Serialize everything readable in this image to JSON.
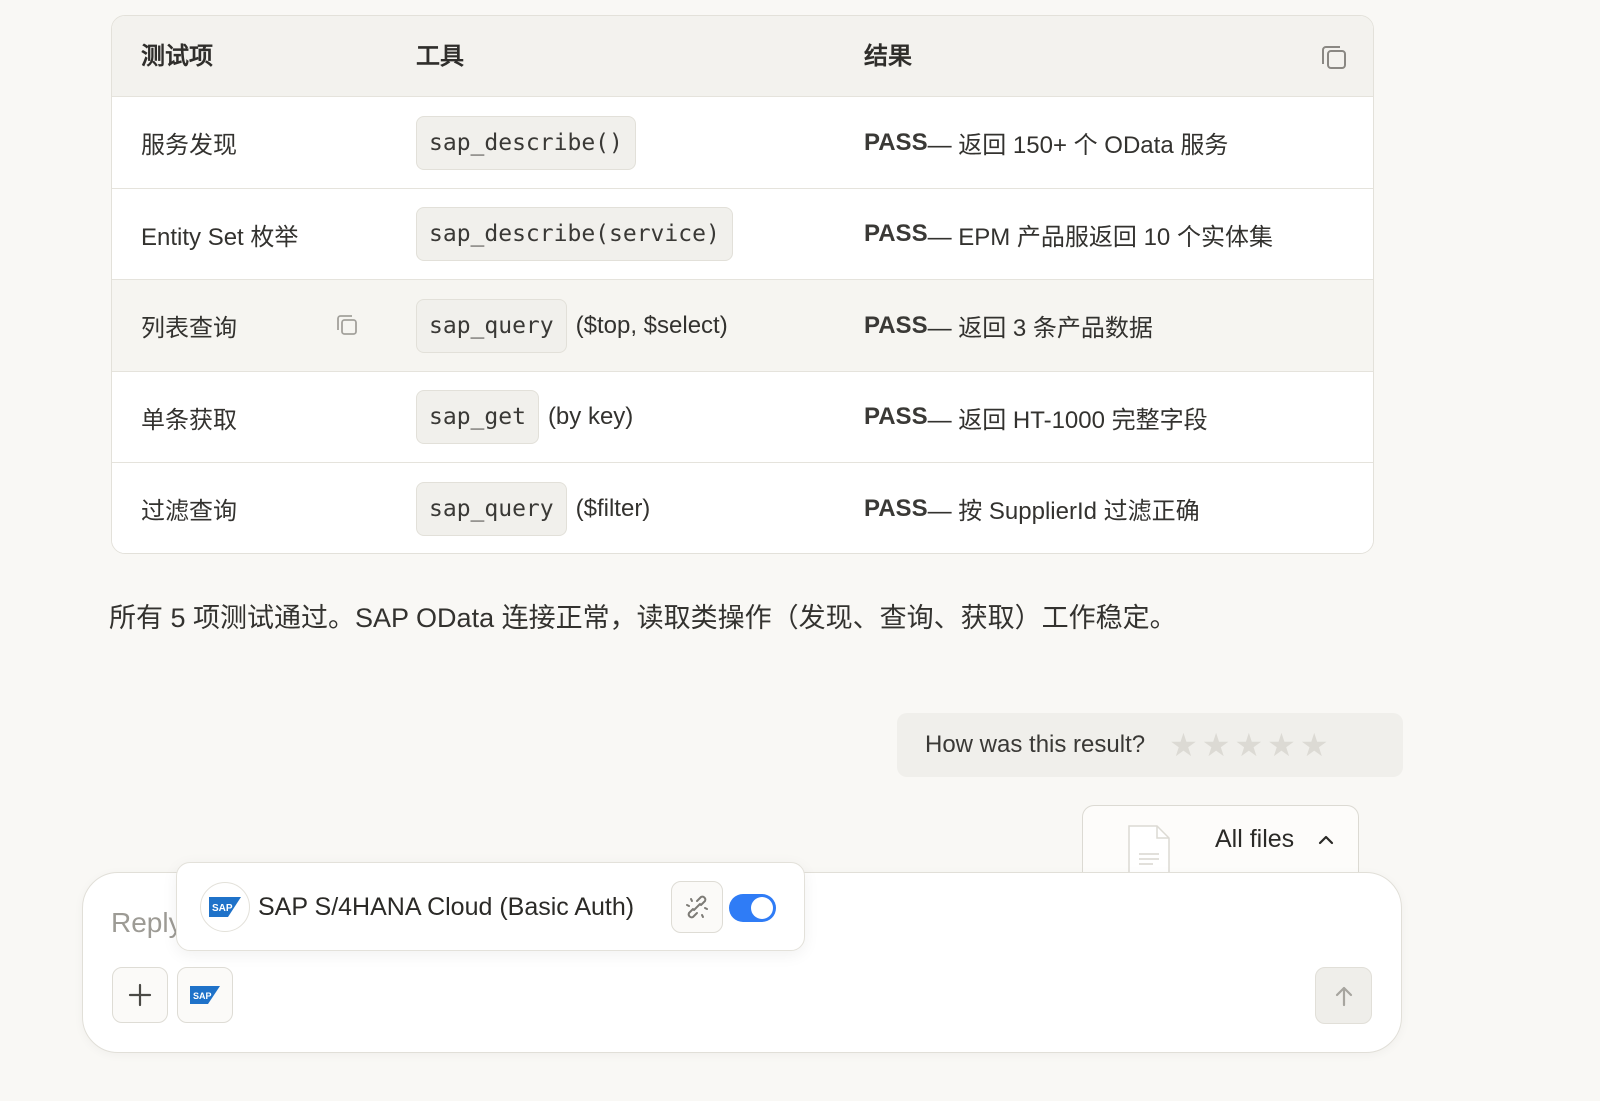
{
  "table": {
    "headers": [
      "测试项",
      "工具",
      "结果"
    ],
    "rows": [
      {
        "item": "服务发现",
        "tool": "sap_describe()",
        "tool_suffix": "",
        "status": "PASS",
        "result": " — 返回 150+ 个 OData 服务"
      },
      {
        "item": "Entity Set 枚举",
        "tool": "sap_describe(service)",
        "tool_suffix": "",
        "status": "PASS",
        "result": " — EPM 产品服返回 10 个实体集"
      },
      {
        "item": "列表查询",
        "tool": "sap_query",
        "tool_suffix": "($top, $select)",
        "status": "PASS",
        "result": " — 返回 3 条产品数据"
      },
      {
        "item": "单条获取",
        "tool": "sap_get",
        "tool_suffix": "(by key)",
        "status": "PASS",
        "result": " — 返回 HT-1000 完整字段"
      },
      {
        "item": "过滤查询",
        "tool": "sap_query",
        "tool_suffix": "($filter)",
        "status": "PASS",
        "result": " — 按 SupplierId 过滤正确"
      }
    ]
  },
  "summary": "所有 5 项测试通过。SAP OData 连接正常，读取类操作（发现、查询、获取）工作稳定。",
  "rating": {
    "prompt": "How was this result?",
    "stars_total": 5,
    "stars_selected": 0
  },
  "files": {
    "label": "All files",
    "icon": "chevron-up-icon"
  },
  "composer": {
    "placeholder": "Reply..."
  },
  "connector": {
    "badge_text": "SAP",
    "name": "SAP S/4HANA Cloud (Basic Auth)",
    "enabled": true
  },
  "colors": {
    "accent": "#2f7cf6",
    "background": "#f9f8f5",
    "table_header": "#f3f2ee"
  }
}
